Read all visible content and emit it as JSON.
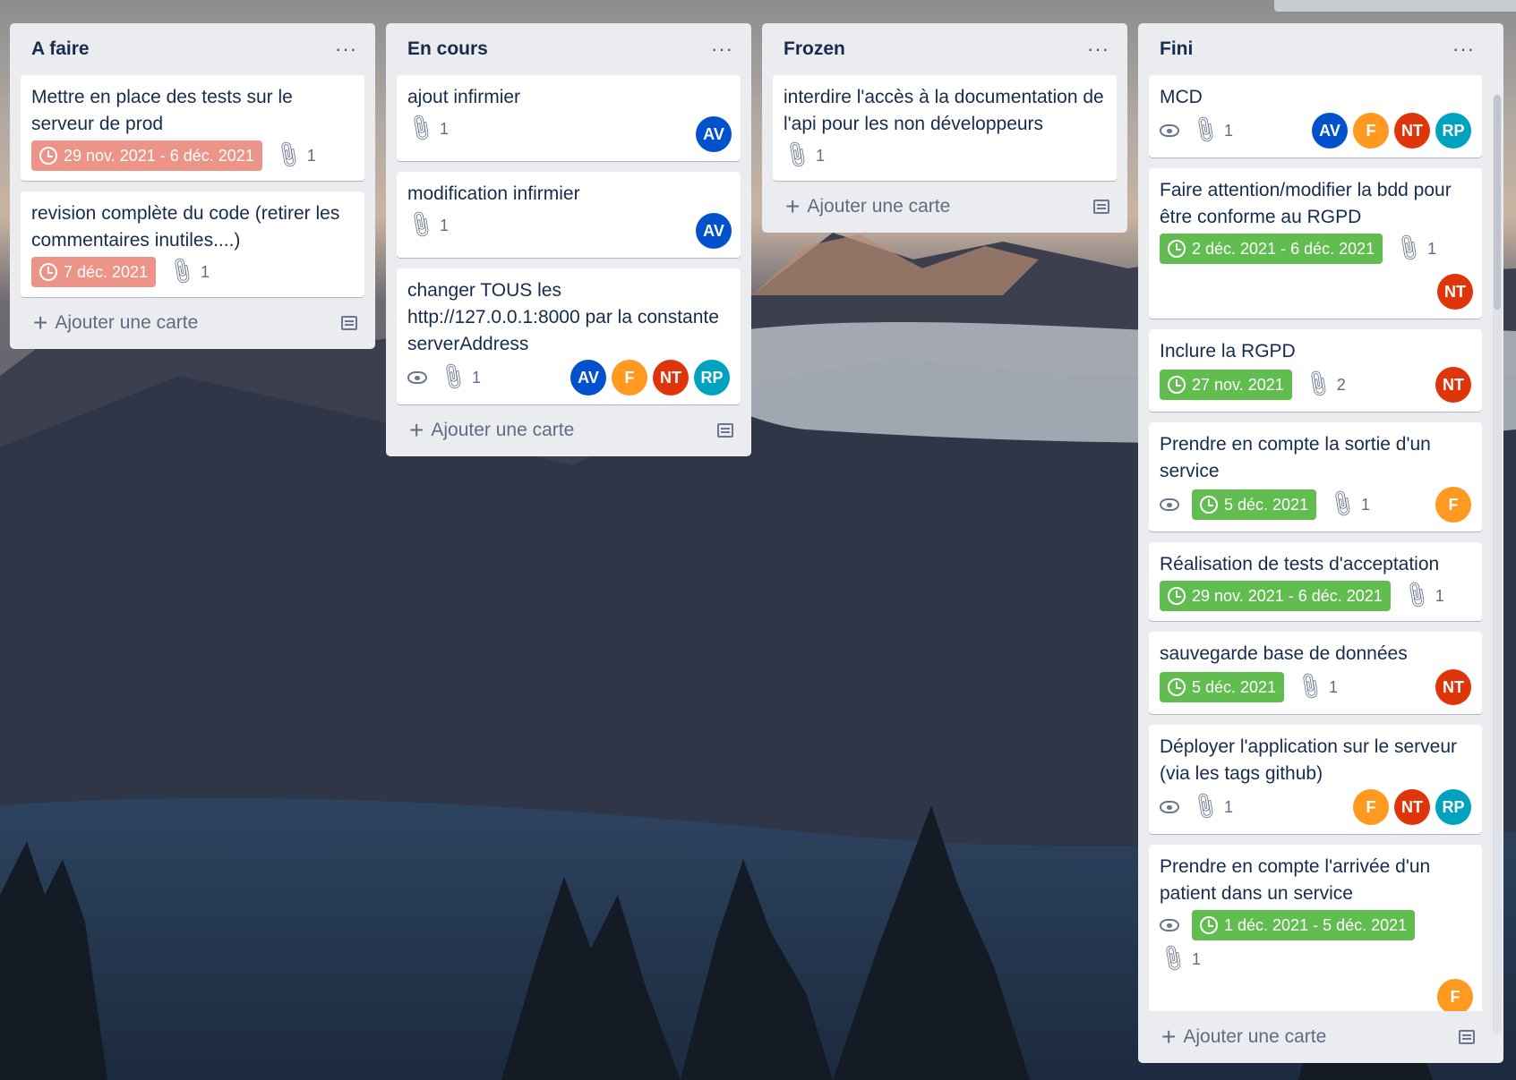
{
  "colors": {
    "list_bg": "#ebecf0",
    "due_overdue": "#ec9488",
    "due_complete": "#61bd4f",
    "avatar_AV": "#0052cc",
    "avatar_F": "#ff991f",
    "avatar_NT": "#de350b",
    "avatar_RP": "#00a3bf"
  },
  "lists": [
    {
      "title": "A faire",
      "menu": "···",
      "add_label": "Ajouter une carte",
      "cards": [
        {
          "title": "Mettre en place des tests sur le serveur de prod",
          "due": "29 nov. 2021 - 6 déc. 2021",
          "due_status": "overdue",
          "attachments": "1",
          "watch": false,
          "members": []
        },
        {
          "title": "revision complète du code (retirer les commentaires inutiles....)",
          "due": "7 déc. 2021",
          "due_status": "overdue",
          "attachments": "1",
          "watch": false,
          "members": []
        }
      ]
    },
    {
      "title": "En cours",
      "menu": "···",
      "add_label": "Ajouter une carte",
      "cards": [
        {
          "title": "ajout infirmier",
          "due": "",
          "attachments": "1",
          "watch": false,
          "members": [
            "AV"
          ]
        },
        {
          "title": "modification infirmier",
          "due": "",
          "attachments": "1",
          "watch": false,
          "members": [
            "AV"
          ]
        },
        {
          "title": "changer TOUS les http://127.0.0.1:8000 par la constante serverAddress",
          "due": "",
          "attachments": "1",
          "watch": true,
          "members": [
            "AV",
            "F",
            "NT",
            "RP"
          ]
        }
      ]
    },
    {
      "title": "Frozen",
      "menu": "···",
      "add_label": "Ajouter une carte",
      "cards": [
        {
          "title": "interdire l'accès à la documentation de l'api pour les non développeurs",
          "due": "",
          "attachments": "1",
          "watch": false,
          "members": []
        }
      ]
    },
    {
      "title": "Fini",
      "menu": "···",
      "add_label": "Ajouter une carte",
      "cards": [
        {
          "title": "MCD",
          "due": "",
          "attachments": "1",
          "watch": true,
          "members": [
            "AV",
            "F",
            "NT",
            "RP"
          ]
        },
        {
          "title": "Faire attention/modifier la bdd pour être conforme au RGPD",
          "due": "2 déc. 2021 - 6 déc. 2021",
          "due_status": "complete",
          "attachments": "1",
          "watch": false,
          "members": [
            "NT"
          ]
        },
        {
          "title": "Inclure la RGPD",
          "due": "27 nov. 2021",
          "due_status": "complete",
          "attachments": "2",
          "watch": false,
          "members": [
            "NT"
          ]
        },
        {
          "title": "Prendre en compte la sortie d'un service",
          "due": "5 déc. 2021",
          "due_status": "complete",
          "attachments": "1",
          "watch": true,
          "members": [
            "F"
          ]
        },
        {
          "title": "Réalisation de tests d'acceptation",
          "due": "29 nov. 2021 - 6 déc. 2021",
          "due_status": "complete",
          "attachments": "1",
          "watch": false,
          "members": []
        },
        {
          "title": "sauvegarde base de données",
          "due": "5 déc. 2021",
          "due_status": "complete",
          "attachments": "1",
          "watch": false,
          "members": [
            "NT"
          ]
        },
        {
          "title": "Déployer l'application sur le serveur (via les tags github)",
          "due": "",
          "attachments": "1",
          "watch": true,
          "members": [
            "F",
            "NT",
            "RP"
          ]
        },
        {
          "title": "Prendre en compte l'arrivée d'un patient dans un service",
          "due": "1 déc. 2021 - 5 déc. 2021",
          "due_status": "complete",
          "attachments": "1",
          "watch": true,
          "members": [
            "F"
          ]
        }
      ]
    }
  ]
}
